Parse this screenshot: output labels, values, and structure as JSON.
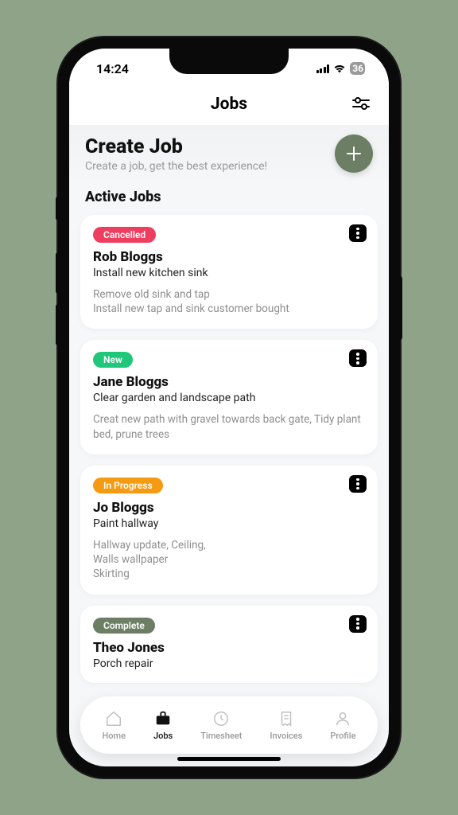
{
  "status": {
    "time": "14:24",
    "battery": "36"
  },
  "header": {
    "title": "Jobs"
  },
  "create": {
    "title": "Create Job",
    "subtitle": "Create a job, get the best experience!"
  },
  "section_title": "Active Jobs",
  "badge_colors": {
    "cancelled": "#ef3d60",
    "new": "#1ec779",
    "in_progress": "#f59b13",
    "complete": "#6c7e63"
  },
  "jobs": [
    {
      "status": "Cancelled",
      "status_key": "cancelled",
      "name": "Rob Bloggs",
      "summary": "Install new kitchen sink",
      "desc": "Remove old sink and tap\nInstall new tap and sink customer bought"
    },
    {
      "status": "New",
      "status_key": "new",
      "name": "Jane Bloggs",
      "summary": "Clear garden and landscape path",
      "desc": "Creat new path with gravel towards back gate, Tidy plant bed, prune trees"
    },
    {
      "status": "In Progress",
      "status_key": "in_progress",
      "name": "Jo Bloggs",
      "summary": "Paint hallway",
      "desc": "Hallway update, Ceiling,\nWalls wallpaper\nSkirting"
    },
    {
      "status": "Complete",
      "status_key": "complete",
      "name": "Theo Jones",
      "summary": "Porch repair",
      "desc": ""
    }
  ],
  "nav": {
    "items": [
      {
        "label": "Home",
        "active": false
      },
      {
        "label": "Jobs",
        "active": true
      },
      {
        "label": "Timesheet",
        "active": false
      },
      {
        "label": "Invoices",
        "active": false
      },
      {
        "label": "Profile",
        "active": false
      }
    ]
  }
}
